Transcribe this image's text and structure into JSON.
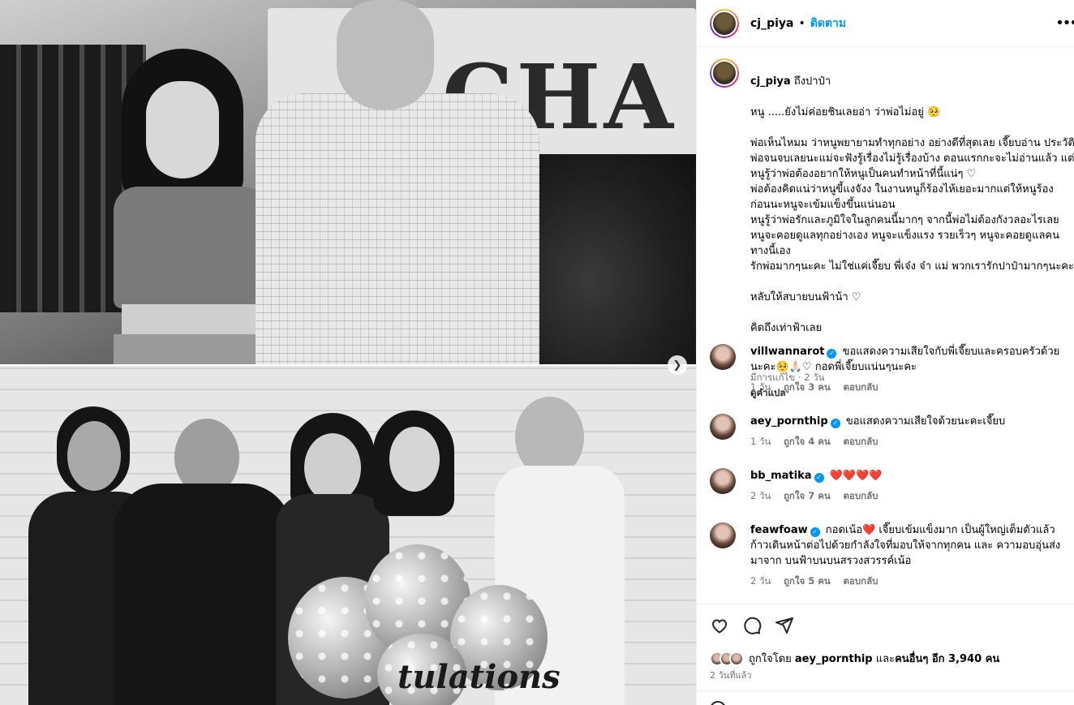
{
  "post": {
    "username": "cj_piya",
    "separator": "•",
    "follow_label": "ติดตาม",
    "caption_title": "ถึงปาป๋า",
    "caption_body": "หนู .....ยังไม่ค่อยชินเลยอ่า ว่าพ่อไม่อยู่ 🥺\n\nพ่อเห็นไหมม ว่าหนูพยายามทำทุกอย่าง อย่างดีที่สุดเลย เจี๊ยบอ่าน ประวัติพ่อจนจบเลยนะแม่จะฟังรู้เรื่องไม่รู้เรื่องบ้าง ตอนแรกกะจะไม่อ่านแล้ว แต่หนูรู้ว่าพ่อต้องอยากให้หนูเป็นคนทำหน้าที่นี้แน่ๆ ♡\nพ่อต้องคิดแน่ว่าหนูขี้แงจังง ในงานหนูก็ร้องไห้เยอะมากแต่ให้หนูร้อง ก่อนนะหนูจะเข้มแข็งขึ้นแน่นอน\nหนูรู้ว่าพ่อรักและภูมิใจในลูกคนนี้มากๆ จากนี้พ่อไม่ต้องกังวลอะไรเลย หนูจะคอยดูแลทุกอย่างเอง หนูจะแข็งแรง รวยเร็วๆ หนูจะคอยดูแลคน ทางนี้เอง\nรักพ่อมากๆนะคะ ไม่ใช่แค่เจี๊ยบ พี่เจ๋ง จ๋า แม่ พวกเรารักปาป๋ามากๆนะคะ\n\nหลับให้สบายบนฟ้าน้า ♡\n\nคิดถึงเท่าฟ้าเลย",
    "caption_meta": "มีการแก้ไข · 2 วัน",
    "translate_label": "ดูคำแปล",
    "photo_text_top": "CHA",
    "photo_text_bottom": "tulations"
  },
  "comments": [
    {
      "user": "villwannarot",
      "text": "ขอแสดงความเสียใจกับพี่เจี๊ยบและครอบครัวด้วยนะคะ🥺🙏🏻♡ กอดพี่เจี๊ยบแน่นๆนะคะ",
      "time": "1 วัน",
      "likes": "ถูกใจ 3 คน",
      "reply": "ตอบกลับ"
    },
    {
      "user": "aey_pornthip",
      "text": "ขอแสดงความเสียใจด้วยนะคะเจี๊ยบ",
      "time": "1 วัน",
      "likes": "ถูกใจ 4 คน",
      "reply": "ตอบกลับ"
    },
    {
      "user": "bb_matika",
      "text": "❤️❤️❤️❤️",
      "time": "2 วัน",
      "likes": "ถูกใจ 7 คน",
      "reply": "ตอบกลับ"
    },
    {
      "user": "feawfoaw",
      "text": "กอดเน้อ❤️ เจี๊ยบเข้มแข็งมาก เป็นผู้ใหญ่เต็มตัวแล้ว ก้าวเดินหน้าต่อไปด้วยกำลังใจที่มอบให้จากทุกคน และ ความอบอุ่นส่งมาจาก บนฟ้าบนบนสรวงสวรรค์เน้อ",
      "time": "2 วัน",
      "likes": "ถูกใจ 5 คน",
      "reply": "ตอบกลับ"
    }
  ],
  "likes": {
    "prefix": "ถูกใจโดย",
    "user": "aey_pornthip",
    "middle": "และ",
    "others": "คนอื่นๆ อีก 3,940 คน",
    "time_ago": "2 วันที่แล้ว"
  },
  "icons": {
    "like": "heart-icon",
    "comment": "comment-icon",
    "share": "share-icon",
    "next": "chevron-right-icon",
    "verified": "verified-badge-icon",
    "more": "more-icon"
  },
  "colors": {
    "accent": "#0095f6",
    "muted": "#737373"
  }
}
